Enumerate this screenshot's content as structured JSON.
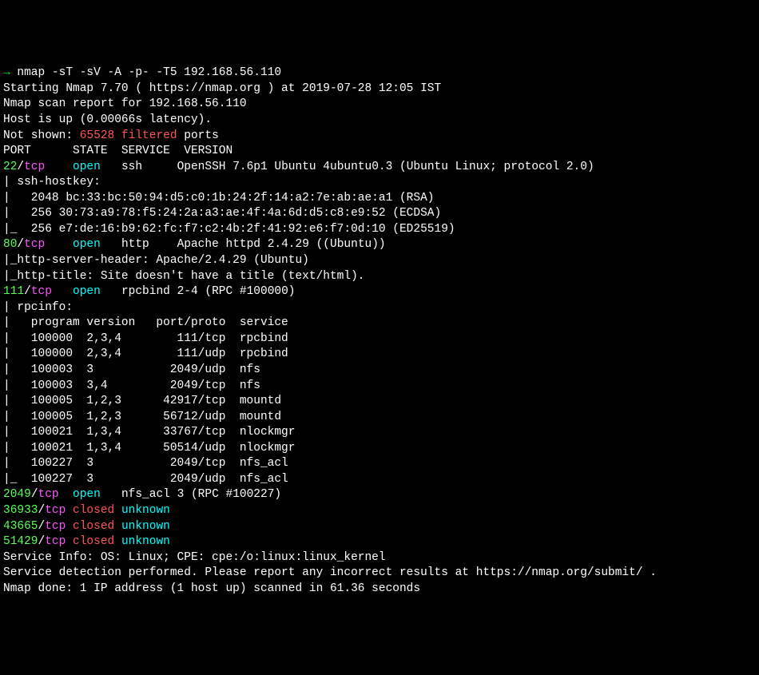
{
  "prompt": {
    "arrow": "→",
    "command": " nmap -sT -sV -A -p- -T5 192.168.56.110"
  },
  "lines": {
    "starting": "Starting Nmap 7.70 ( https://nmap.org ) at 2019-07-28 12:05 IST",
    "scan_report": "Nmap scan report for 192.168.56.110",
    "host_up": "Host is up (0.00066s latency).",
    "not_shown_pre": "Not shown: ",
    "not_shown_num": "65528",
    "not_shown_filtered": " filtered",
    "not_shown_post": " ports",
    "header": "PORT      STATE  SERVICE  VERSION"
  },
  "port22": {
    "port": "22",
    "slash": "/",
    "proto": "tcp",
    "sep1": "    ",
    "state": "open",
    "sep2": "   ",
    "service": "ssh",
    "sep3": "     ",
    "version": "OpenSSH 7.6p1 Ubuntu 4ubuntu0.3 (Ubuntu Linux; protocol 2.0)",
    "hostkey_header": "| ssh-hostkey:",
    "rsa": "|   2048 bc:33:bc:50:94:d5:c0:1b:24:2f:14:a2:7e:ab:ae:a1 (RSA)",
    "ecdsa": "|   256 30:73:a9:78:f5:24:2a:a3:ae:4f:4a:6d:d5:c8:e9:52 (ECDSA)",
    "ed25519": "|_  256 e7:de:16:b9:62:fc:f7:c2:4b:2f:41:92:e6:f7:0d:10 (ED25519)"
  },
  "port80": {
    "port": "80",
    "slash": "/",
    "proto": "tcp",
    "sep1": "    ",
    "state": "open",
    "sep2": "   ",
    "service": "http",
    "sep3": "    ",
    "version": "Apache httpd 2.4.29 ((Ubuntu))",
    "header": "|_http-server-header: Apache/2.4.29 (Ubuntu)",
    "title": "|_http-title: Site doesn't have a title (text/html)."
  },
  "port111": {
    "port": "111",
    "slash": "/",
    "proto": "tcp",
    "sep1": "   ",
    "state": "open",
    "sep2": "   ",
    "service": "rpcbind",
    "sep3": " ",
    "version": "2-4 (RPC #100000)",
    "rpcinfo": "| rpcinfo:",
    "rpc_header": "|   program version   port/proto  service",
    "rpc1": "|   100000  2,3,4        111/tcp  rpcbind",
    "rpc2": "|   100000  2,3,4        111/udp  rpcbind",
    "rpc3": "|   100003  3           2049/udp  nfs",
    "rpc4": "|   100003  3,4         2049/tcp  nfs",
    "rpc5": "|   100005  1,2,3      42917/tcp  mountd",
    "rpc6": "|   100005  1,2,3      56712/udp  mountd",
    "rpc7": "|   100021  1,3,4      33767/tcp  nlockmgr",
    "rpc8": "|   100021  1,3,4      50514/udp  nlockmgr",
    "rpc9": "|   100227  3           2049/tcp  nfs_acl",
    "rpc10": "|_  100227  3           2049/udp  nfs_acl"
  },
  "port2049": {
    "port": "2049",
    "slash": "/",
    "proto": "tcp",
    "sep1": "  ",
    "state": "open",
    "sep2": "   ",
    "service": "nfs_acl",
    "sep3": " ",
    "version": "3 (RPC #100227)"
  },
  "port36933": {
    "port": "36933",
    "slash": "/",
    "proto": "tcp",
    "sep1": " ",
    "state": "closed",
    "sep2": " ",
    "service": "unknown"
  },
  "port43665": {
    "port": "43665",
    "slash": "/",
    "proto": "tcp",
    "sep1": " ",
    "state": "closed",
    "sep2": " ",
    "service": "unknown"
  },
  "port51429": {
    "port": "51429",
    "slash": "/",
    "proto": "tcp",
    "sep1": " ",
    "state": "closed",
    "sep2": " ",
    "service": "unknown"
  },
  "footer": {
    "service_info": "Service Info: OS: Linux; CPE: cpe:/o:linux:linux_kernel",
    "blank": "",
    "detection": "Service detection performed. Please report any incorrect results at https://nmap.org/submit/ .",
    "done": "Nmap done: 1 IP address (1 host up) scanned in 61.36 seconds"
  }
}
